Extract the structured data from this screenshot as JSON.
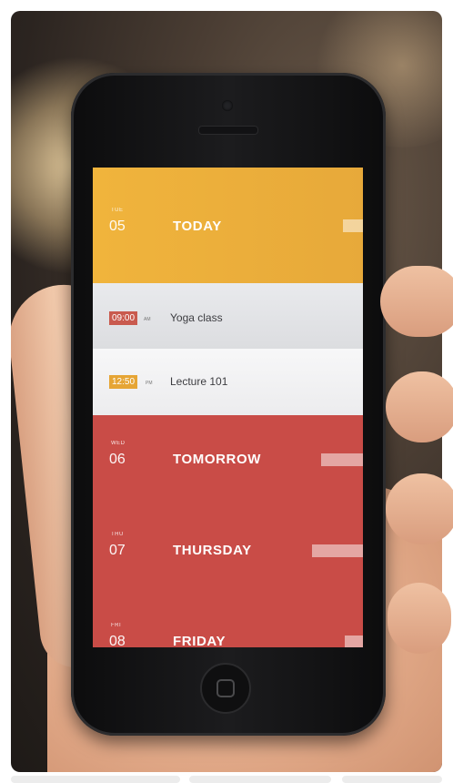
{
  "calendar": {
    "days": [
      {
        "weekday": "TUE",
        "date": "05",
        "label": "TODAY"
      },
      {
        "weekday": "WED",
        "date": "06",
        "label": "TOMORROW"
      },
      {
        "weekday": "THU",
        "date": "07",
        "label": "THURSDAY"
      },
      {
        "weekday": "FRI",
        "date": "08",
        "label": "FRIDAY"
      }
    ],
    "events": [
      {
        "time": "09:00",
        "ampm": "AM",
        "title": "Yoga class"
      },
      {
        "time": "12:50",
        "ampm": "PM",
        "title": "Lecture 101"
      }
    ]
  },
  "colors": {
    "today": "#f0b43c",
    "day_red": "#c94c47",
    "event_bg": "#e9eaed",
    "time_badge_red": "#c95a4e",
    "time_badge_yellow": "#e6a535"
  }
}
